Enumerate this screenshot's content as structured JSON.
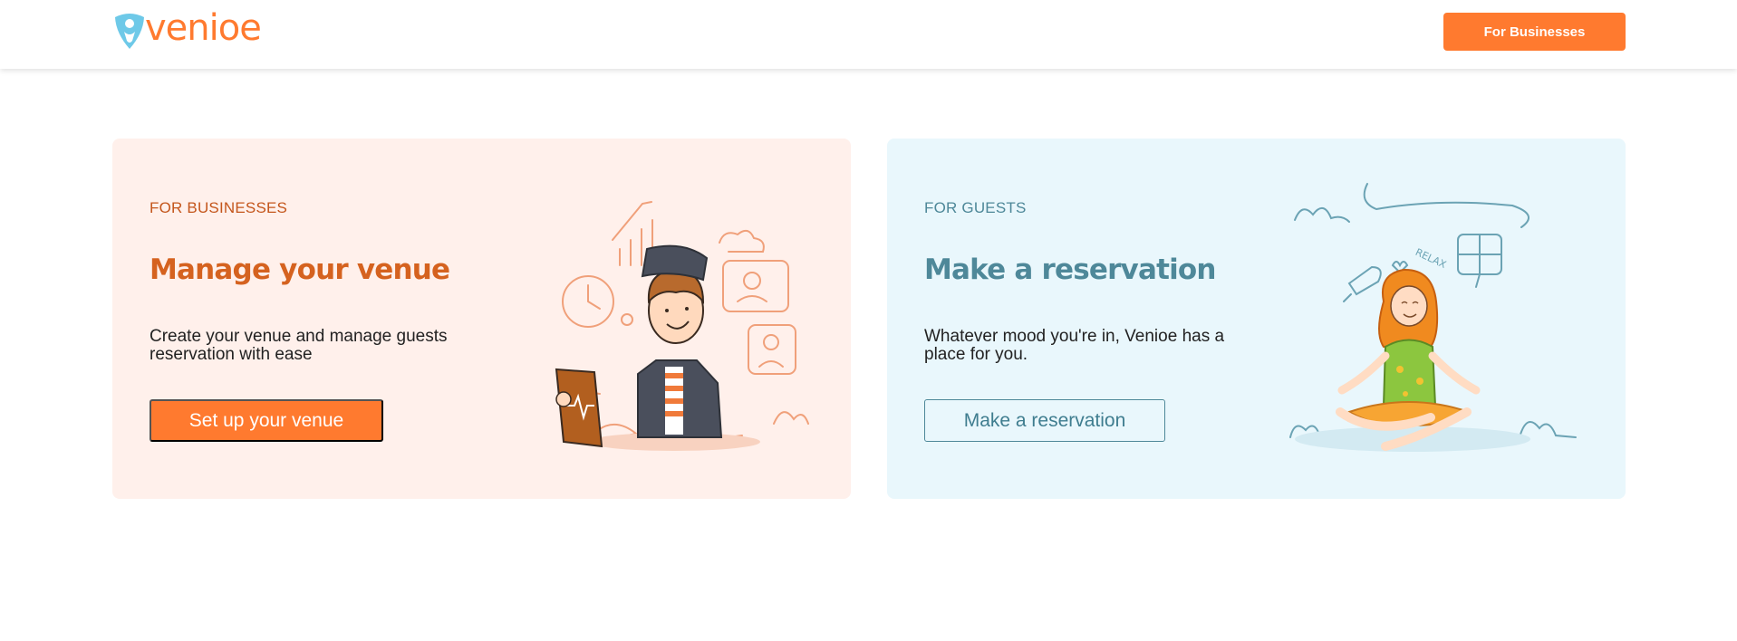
{
  "header": {
    "logo_text": "venioe",
    "cta_label": "For Businesses"
  },
  "cards": {
    "business": {
      "eyebrow": "FOR BUSINESSES",
      "title": "Manage your venue",
      "description": "Create your venue and manage guests reservation with ease",
      "cta_label": "Set up your venue"
    },
    "guest": {
      "eyebrow": "FOR GUESTS",
      "title": "Make a reservation",
      "description": "Whatever mood you're in, Venioe has a place for you.",
      "cta_label": "Make a reservation",
      "illustration_text": "RELAX"
    }
  },
  "colors": {
    "brand_orange": "#ff7a2f",
    "logo_blue": "#6ec9e8",
    "business_bg": "#fff0eb",
    "guest_bg": "#e9f7fc",
    "guest_accent": "#4e8899"
  }
}
